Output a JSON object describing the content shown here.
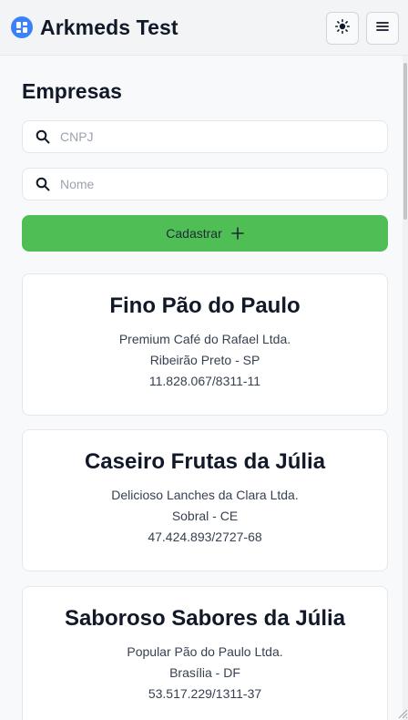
{
  "header": {
    "title": "Arkmeds Test",
    "icons": {
      "logo": "dashboard-icon",
      "theme": "sun-icon",
      "menu": "hamburger-menu-icon"
    }
  },
  "main": {
    "page_title": "Empresas",
    "search_cnpj": {
      "placeholder": "CNPJ",
      "value": ""
    },
    "search_nome": {
      "placeholder": "Nome",
      "value": ""
    },
    "register_button": {
      "label": "Cadastrar",
      "icon": "plus-icon"
    },
    "companies": [
      {
        "name": "Fino Pão do Paulo",
        "legal_name": "Premium Café do Rafael Ltda.",
        "location": "Ribeirão Preto - SP",
        "cnpj": "11.828.067/8311-11"
      },
      {
        "name": "Caseiro Frutas da Júlia",
        "legal_name": "Delicioso Lanches da Clara Ltda.",
        "location": "Sobral - CE",
        "cnpj": "47.424.893/2727-68"
      },
      {
        "name": "Saboroso Sabores da Júlia",
        "legal_name": "Popular Pão do Paulo Ltda.",
        "location": "Brasília - DF",
        "cnpj": "53.517.229/1311-37"
      }
    ]
  },
  "colors": {
    "accent_green": "#4fbf55",
    "logo_blue": "#3b82f6",
    "header_bg": "#f3f4f6",
    "page_bg": "#f8f9fb"
  }
}
